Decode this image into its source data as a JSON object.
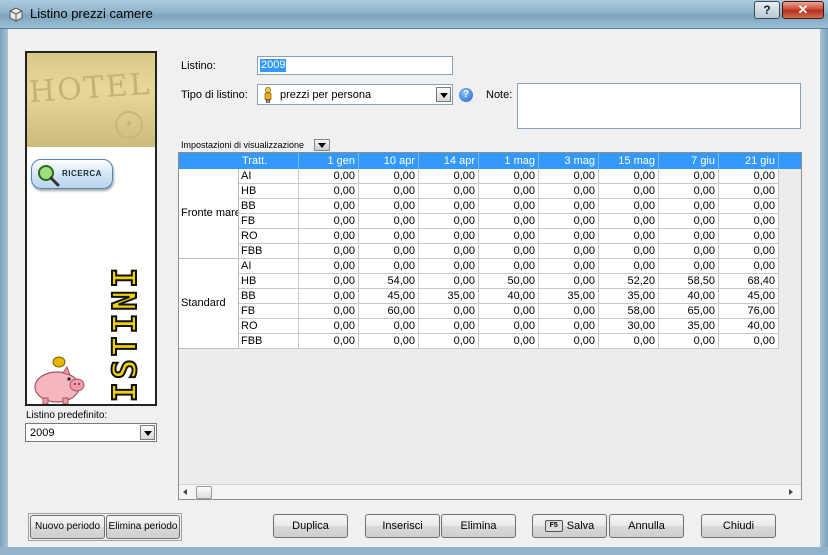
{
  "window": {
    "title": "Listino prezzi camere",
    "help_label": "?",
    "close_label": "✕"
  },
  "side": {
    "ricerca_label": "RICERCA",
    "panel_text": "LISTINI",
    "hotel_text": "HOTEL",
    "predefinito_label": "Listino predefinito:",
    "predefinito_value": "2009"
  },
  "form": {
    "listino_label": "Listino:",
    "listino_value": "2009",
    "tipo_label": "Tipo di listino:",
    "tipo_value": "prezzi per persona",
    "help_label": "?",
    "note_label": "Note:",
    "note_value": "",
    "view_settings_label": "Impostazioni di visualizzazione"
  },
  "grid": {
    "columns": [
      "Tratt.",
      "1 gen",
      "10 apr",
      "14 apr",
      "1 mag",
      "3 mag",
      "15 mag",
      "7 giu",
      "21 giu"
    ],
    "groups": [
      {
        "name": "Fronte mare",
        "rows": [
          {
            "tratt": "AI",
            "values": [
              "0,00",
              "0,00",
              "0,00",
              "0,00",
              "0,00",
              "0,00",
              "0,00",
              "0,00"
            ]
          },
          {
            "tratt": "HB",
            "values": [
              "0,00",
              "0,00",
              "0,00",
              "0,00",
              "0,00",
              "0,00",
              "0,00",
              "0,00"
            ]
          },
          {
            "tratt": "BB",
            "values": [
              "0,00",
              "0,00",
              "0,00",
              "0,00",
              "0,00",
              "0,00",
              "0,00",
              "0,00"
            ]
          },
          {
            "tratt": "FB",
            "values": [
              "0,00",
              "0,00",
              "0,00",
              "0,00",
              "0,00",
              "0,00",
              "0,00",
              "0,00"
            ]
          },
          {
            "tratt": "RO",
            "values": [
              "0,00",
              "0,00",
              "0,00",
              "0,00",
              "0,00",
              "0,00",
              "0,00",
              "0,00"
            ]
          },
          {
            "tratt": "FBB",
            "values": [
              "0,00",
              "0,00",
              "0,00",
              "0,00",
              "0,00",
              "0,00",
              "0,00",
              "0,00"
            ]
          }
        ]
      },
      {
        "name": "Standard",
        "rows": [
          {
            "tratt": "AI",
            "values": [
              "0,00",
              "0,00",
              "0,00",
              "0,00",
              "0,00",
              "0,00",
              "0,00",
              "0,00"
            ]
          },
          {
            "tratt": "HB",
            "values": [
              "0,00",
              "54,00",
              "0,00",
              "50,00",
              "0,00",
              "52,20",
              "58,50",
              "68,40"
            ]
          },
          {
            "tratt": "BB",
            "values": [
              "0,00",
              "45,00",
              "35,00",
              "40,00",
              "35,00",
              "35,00",
              "40,00",
              "45,00"
            ]
          },
          {
            "tratt": "FB",
            "values": [
              "0,00",
              "60,00",
              "0,00",
              "0,00",
              "0,00",
              "58,00",
              "65,00",
              "76,00"
            ]
          },
          {
            "tratt": "RO",
            "values": [
              "0,00",
              "0,00",
              "0,00",
              "0,00",
              "0,00",
              "30,00",
              "35,00",
              "40,00"
            ]
          },
          {
            "tratt": "FBB",
            "values": [
              "0,00",
              "0,00",
              "0,00",
              "0,00",
              "0,00",
              "0,00",
              "0,00",
              "0,00"
            ]
          }
        ]
      }
    ]
  },
  "buttons": {
    "nuovo_periodo": "Nuovo periodo",
    "elimina_periodo": "Elimina periodo",
    "duplica": "Duplica",
    "inserisci": "Inserisci",
    "elimina": "Elimina",
    "salva_key": "F5",
    "salva": "Salva",
    "annulla": "Annulla",
    "chiudi": "Chiudi"
  },
  "colors": {
    "header_bg": "#3399ff",
    "listini_text": "#f0d200"
  }
}
